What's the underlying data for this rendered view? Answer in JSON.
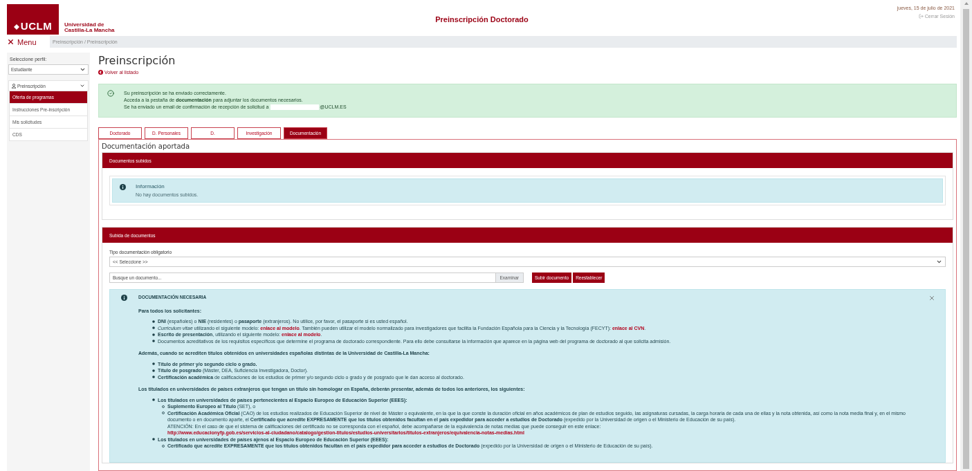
{
  "header": {
    "logo_mark": "UCLM",
    "logo_name": [
      "Universidad de",
      "Castilla-La Mancha"
    ],
    "title": "Preinscripción Doctorado",
    "date": "jueves, 15 de julio de 2021",
    "logout": "Cerrar Sesión"
  },
  "menu_toggle": "Menu",
  "breadcrumb": "Preinscripción / Preinscripción",
  "sidebar": {
    "profile_label": "Seleccione perfil:",
    "profile_value": "Estudiante",
    "group": {
      "label": "Preinscripción",
      "expanded": true,
      "items": [
        {
          "label": "Oferta de programas",
          "selected": true
        },
        {
          "label": "Instrucciones Pre-inscripción",
          "selected": false
        },
        {
          "label": "Mis solicitudes",
          "selected": false
        },
        {
          "label": "CDS",
          "selected": false
        }
      ]
    }
  },
  "page": {
    "title": "Preinscripción",
    "back_link": "Volver al listado"
  },
  "success_alert": {
    "lines": [
      "Su preinscripción se ha enviado correctamente.",
      "Acceda a la pestaña de **documentación** para adjuntar los documentos necesarios."
    ],
    "email_text": "Se ha enviado un email de confirmación de recepción de solicitud a",
    "email_domain": "@UCLM.ES"
  },
  "tabs": [
    {
      "label": "Doctorado",
      "selected": false
    },
    {
      "label": "D. Personales",
      "selected": false
    },
    {
      "label": "D.",
      "selected": false
    },
    {
      "label": "Investigación",
      "selected": false
    },
    {
      "label": "Documentación",
      "selected": true
    }
  ],
  "section_title": "Documentación aportada",
  "uploaded_card": {
    "title": "Documentos subidos",
    "info_title": "Información",
    "info_text": "No hay documentos subidos."
  },
  "upload_card": {
    "title": "Subida de documentos",
    "type_label": "Tipo documentación obligatorio",
    "type_value": "<< Seleccione >>",
    "file_placeholder": "Busque un documento...",
    "browse": "Examinar",
    "buttons": [
      "Subir documento",
      "Reestablecer"
    ]
  },
  "requirements": {
    "title": "DOCUMENTACIÓN NECESARIA",
    "sections": [
      {
        "heading": "Para todos los solicitantes:",
        "items": [
          {
            "bold": false,
            "parts": [
              {
                "kind": "text",
                "text": "**DNI** (españoles) o **NIE** (residentes) o **pasaporte** (extranjeros). No utilice, por favor, el pasaporte si es usted español."
              }
            ]
          },
          {
            "bold": false,
            "parts": [
              {
                "kind": "text",
                "text": "*Curriculum vitae* utilizando el siguiente modelo: "
              },
              {
                "kind": "link",
                "text": "enlace al modelo"
              },
              {
                "kind": "text",
                "text": ". También pueden utilizar el modelo normalizado para investigadores que facilita la Fundación Española para la Ciencia y la Tecnología (FECYT): "
              },
              {
                "kind": "link",
                "text": "enlace al CVN"
              },
              {
                "kind": "text",
                "text": "."
              }
            ]
          },
          {
            "bold": false,
            "parts": [
              {
                "kind": "text",
                "text": "**Escrito de presentación**, utilizando el siguiente modelo: "
              },
              {
                "kind": "link",
                "text": "enlace al modelo"
              },
              {
                "kind": "text",
                "text": "."
              }
            ]
          },
          {
            "bold": false,
            "parts": [
              {
                "kind": "text",
                "text": "Documentos acreditativos de los requisitos específicos que determine el programa de doctorado correspondiente. Para ello debe consultarse la información que aparece en la página web del programa de doctorado al que solicita admisión."
              }
            ]
          }
        ]
      },
      {
        "heading": "Además, cuando se acrediten títulos obtenidos en universidades españolas distintas de la Universidad de Castilla-La Mancha:",
        "items": [
          {
            "bold": true,
            "parts": [
              {
                "kind": "text",
                "text": "Título de primer y/o segundo ciclo o grado."
              }
            ]
          },
          {
            "bold": false,
            "parts": [
              {
                "kind": "text",
                "text": "**Título de posgrado** (Máster, DEA, Suficiencia Investigadora, Doctor)."
              }
            ]
          },
          {
            "bold": false,
            "parts": [
              {
                "kind": "text",
                "text": "**Certificación académica** de calificaciones de los estudios de primer y/o segundo ciclo o grado y de posgrado que le dan acceso al doctorado."
              }
            ]
          }
        ]
      },
      {
        "heading": "Los titulados en universidades de países extranjeros que tengan un título sin homologar en España, deberán presentar, además de todos los anteriores, los siguientes:",
        "items": [
          {
            "bold": true,
            "parts": [
              {
                "kind": "text",
                "text": "Los titulados en universidades de países pertenecientes al Espacio Europeo de Educación Superior (EEES):"
              }
            ],
            "children": [
              {
                "bold": false,
                "parts": [
                  {
                    "kind": "text",
                    "text": "**Suplemento Europeo al Título** (SET), o"
                  }
                ]
              },
              {
                "bold": false,
                "parts": [
                  {
                    "kind": "text",
                    "text": "**Certificación Académica Oficial** (CAO) de los estudios realizados de Educación Superior de nivel de Máster o equivalente, en la que la que conste la duración oficial en años académicos de plan de estudios seguido, las asignaturas cursadas, la carga horaria de cada una de ellas y la nota obtenida, así como la nota media final y, en el mismo documento o en documento aparte, el **Certificado que acredite EXPRESAMENTE que los títulos obtenidos facultan en el país expedidor para acceder a estudios de Doctorado** (expedido por la Universidad de origen o el Ministerio de Educación de su país)."
                  },
                  {
                    "kind": "break"
                  },
                  {
                    "kind": "text",
                    "text": "ATENCIÓN: En el caso de que el sistema de calificaciones del certificado no se corresponda con el español, debe acompañarse de la equivalencia de notas medias que puede conseguir en este enlace: "
                  },
                  {
                    "kind": "link",
                    "text": "http://www.educacionyfp.gob.es/servicios-al-ciudadano/catalogo/gestion-titulos/estudios-universitarios/titulos-extranjeros/equivalencia-notas-medias.html"
                  }
                ]
              }
            ]
          },
          {
            "bold": true,
            "parts": [
              {
                "kind": "text",
                "text": "Los titulados en universidades de países ajenos al Espacio Europeo de Educación Superior (EEES):"
              }
            ],
            "children": [
              {
                "bold": false,
                "parts": [
                  {
                    "kind": "text",
                    "text": "**Certificado que acredite EXPRESAMENTE que los títulos obtenidos facultan en el país expedidor para acceder a estudios de Doctorado** (expedido por la Universidad de origen o el Ministerio de Educación de su país)."
                  }
                ]
              }
            ]
          }
        ]
      }
    ]
  }
}
